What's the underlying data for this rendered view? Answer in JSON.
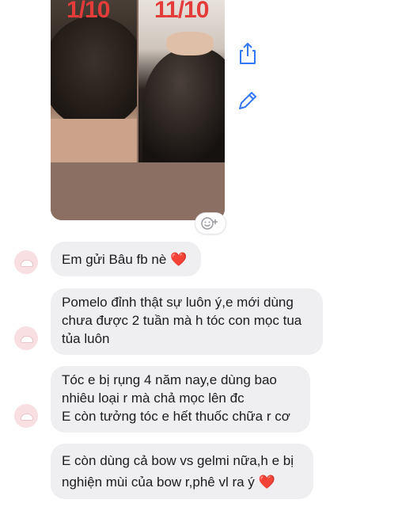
{
  "photo": {
    "date_left": "1/10",
    "date_right": "11/10"
  },
  "actions": {
    "share_icon": "share-icon",
    "edit_icon": "pencil-icon",
    "react_icon": "add-reaction-icon"
  },
  "messages": [
    {
      "lines": [
        "Em gửi Bâu fb nè ❤️"
      ]
    },
    {
      "lines": [
        "Pomelo đỉnh thật sự luôn ý,e mới dùng",
        "chưa được 2 tuần mà h tóc con mọc tua",
        "tủa luôn"
      ]
    },
    {
      "lines": [
        "Tóc e bị rụng 4 năm nay,e dùng bao",
        "nhiêu loại r mà chả mọc lên đc",
        "E còn tưởng tóc e hết thuốc chữa r cơ"
      ]
    },
    {
      "lines": [
        "E còn dùng cả bow vs gelmi nữa,h e bị",
        "nghiện mùi của bow r,phê vl ra ý ❤️"
      ]
    }
  ],
  "colors": {
    "bubble": "#efeff1",
    "accent_blue": "#3478f6",
    "date_red": "#e43b3b",
    "avatar_pink": "#f7dfe2"
  }
}
